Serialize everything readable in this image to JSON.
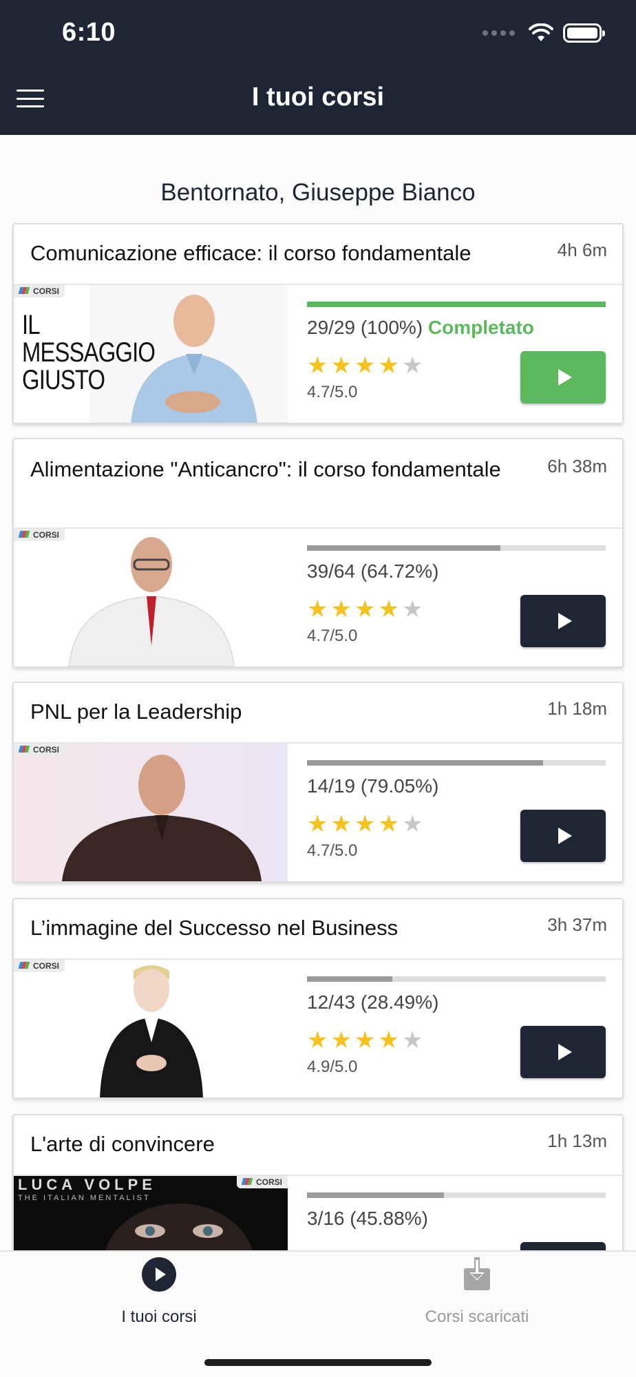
{
  "status_bar": {
    "time": "6:10"
  },
  "nav": {
    "title": "I tuoi corsi",
    "menu_icon": "hamburger-menu-icon"
  },
  "welcome": "Bentornato, Giuseppe Bianco",
  "colors": {
    "header_bg": "#1e2636",
    "completed_green": "#5cb85c",
    "star_yellow": "#f5c11c",
    "progress_grey": "#9a9a9a"
  },
  "courses": [
    {
      "title": "Comunicazione efficace: il corso fondamentale",
      "duration": "4h 6m",
      "thumb_badge": "CORSI",
      "thumb_headline": "IL MESSAGGIO GIUSTO",
      "progress_text": "29/29 (100%)",
      "status": "Completato",
      "progress": 1.0,
      "stars": 4,
      "rating": "4.7/5.0",
      "button_color": "green"
    },
    {
      "title": "Alimentazione \"Anticancro\": il corso fondamentale",
      "duration": "6h 38m",
      "thumb_badge": "CORSI",
      "progress_text": "39/64 (64.72%)",
      "progress": 0.6472,
      "stars": 4,
      "rating": "4.7/5.0",
      "button_color": "dark"
    },
    {
      "title": "PNL per la Leadership",
      "duration": "1h 18m",
      "thumb_badge": "CORSI",
      "progress_text": "14/19 (79.05%)",
      "progress": 0.7905,
      "stars": 4,
      "rating": "4.7/5.0",
      "button_color": "dark"
    },
    {
      "title": "L’immagine del Successo nel Business",
      "duration": "3h 37m",
      "thumb_badge": "CORSI",
      "progress_text": "12/43 (28.49%)",
      "progress": 0.2849,
      "stars": 4,
      "rating": "4.9/5.0",
      "button_color": "dark"
    },
    {
      "title": "L'arte di convincere",
      "duration": "1h 13m",
      "thumb_badge": "CORSI",
      "thumb_headline": "LUCA VOLPE",
      "thumb_subline": "THE ITALIAN MENTALIST",
      "progress_text": "3/16 (45.88%)",
      "progress": 0.4588,
      "button_color": "dark"
    }
  ],
  "tabs": [
    {
      "label": "I tuoi corsi",
      "icon": "play-circle-icon",
      "active": true
    },
    {
      "label": "Corsi scaricati",
      "icon": "download-icon",
      "active": false
    }
  ]
}
